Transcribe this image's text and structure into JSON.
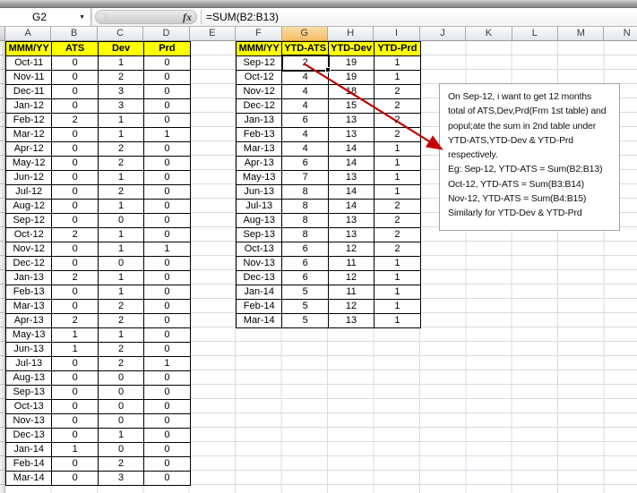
{
  "chrome": {
    "name_box": "G2",
    "fx_label": "fx",
    "formula": "=SUM(B2:B13)"
  },
  "column_headers": {
    "letters": [
      "A",
      "B",
      "C",
      "D",
      "E",
      "F",
      "G",
      "H",
      "I",
      "J",
      "K",
      "L",
      "M",
      "N"
    ],
    "selected": "G"
  },
  "sheet": {
    "table1": {
      "headers": [
        "MMM/YY",
        "ATS",
        "Dev",
        "Prd"
      ],
      "rows": [
        [
          "Oct-11",
          "0",
          "1",
          "0"
        ],
        [
          "Nov-11",
          "0",
          "2",
          "0"
        ],
        [
          "Dec-11",
          "0",
          "3",
          "0"
        ],
        [
          "Jan-12",
          "0",
          "3",
          "0"
        ],
        [
          "Feb-12",
          "2",
          "1",
          "0"
        ],
        [
          "Mar-12",
          "0",
          "1",
          "1"
        ],
        [
          "Apr-12",
          "0",
          "2",
          "0"
        ],
        [
          "May-12",
          "0",
          "2",
          "0"
        ],
        [
          "Jun-12",
          "0",
          "1",
          "0"
        ],
        [
          "Jul-12",
          "0",
          "2",
          "0"
        ],
        [
          "Aug-12",
          "0",
          "1",
          "0"
        ],
        [
          "Sep-12",
          "0",
          "0",
          "0"
        ],
        [
          "Oct-12",
          "2",
          "1",
          "0"
        ],
        [
          "Nov-12",
          "0",
          "1",
          "1"
        ],
        [
          "Dec-12",
          "0",
          "0",
          "0"
        ],
        [
          "Jan-13",
          "2",
          "1",
          "0"
        ],
        [
          "Feb-13",
          "0",
          "1",
          "0"
        ],
        [
          "Mar-13",
          "0",
          "2",
          "0"
        ],
        [
          "Apr-13",
          "2",
          "2",
          "0"
        ],
        [
          "May-13",
          "1",
          "1",
          "0"
        ],
        [
          "Jun-13",
          "1",
          "2",
          "0"
        ],
        [
          "Jul-13",
          "0",
          "2",
          "1"
        ],
        [
          "Aug-13",
          "0",
          "0",
          "0"
        ],
        [
          "Sep-13",
          "0",
          "0",
          "0"
        ],
        [
          "Oct-13",
          "0",
          "0",
          "0"
        ],
        [
          "Nov-13",
          "0",
          "0",
          "0"
        ],
        [
          "Dec-13",
          "0",
          "1",
          "0"
        ],
        [
          "Jan-14",
          "1",
          "0",
          "0"
        ],
        [
          "Feb-14",
          "0",
          "2",
          "0"
        ],
        [
          "Mar-14",
          "0",
          "3",
          "0"
        ]
      ]
    },
    "table2": {
      "headers": [
        "MMM/YY",
        "YTD-ATS",
        "YTD-Dev",
        "YTD-Prd"
      ],
      "rows": [
        [
          "Sep-12",
          "2",
          "19",
          "1"
        ],
        [
          "Oct-12",
          "4",
          "19",
          "1"
        ],
        [
          "Nov-12",
          "4",
          "18",
          "2"
        ],
        [
          "Dec-12",
          "4",
          "15",
          "2"
        ],
        [
          "Jan-13",
          "6",
          "13",
          "2"
        ],
        [
          "Feb-13",
          "4",
          "13",
          "2"
        ],
        [
          "Mar-13",
          "4",
          "14",
          "1"
        ],
        [
          "Apr-13",
          "6",
          "14",
          "1"
        ],
        [
          "May-13",
          "7",
          "13",
          "1"
        ],
        [
          "Jun-13",
          "8",
          "14",
          "1"
        ],
        [
          "Jul-13",
          "8",
          "14",
          "2"
        ],
        [
          "Aug-13",
          "8",
          "13",
          "2"
        ],
        [
          "Sep-13",
          "8",
          "13",
          "2"
        ],
        [
          "Oct-13",
          "6",
          "12",
          "2"
        ],
        [
          "Nov-13",
          "6",
          "11",
          "1"
        ],
        [
          "Dec-13",
          "6",
          "12",
          "1"
        ],
        [
          "Jan-14",
          "5",
          "11",
          "1"
        ],
        [
          "Feb-14",
          "5",
          "12",
          "1"
        ],
        [
          "Mar-14",
          "5",
          "13",
          "1"
        ]
      ]
    },
    "selection": {
      "cell_ref": "G2",
      "value": "2"
    },
    "annotation": {
      "lines": [
        "On Sep-12, i want to get 12 months",
        "total of ATS,Dev,Prd(Frm 1st table) and",
        "popul;ate the sum in 2nd table under",
        "YTD-ATS,YTD-Dev & YTD-Prd",
        "respectively.",
        "Eg: Sep-12, YTD-ATS = Sum(B2:B13)",
        "Oct-12, YTD-ATS = Sum(B3:B14)",
        "Nov-12, YTD-ATS = Sum(B4:B15)",
        "Similarly for YTD-Dev & YTD-Prd"
      ]
    }
  },
  "colors": {
    "header_yellow": "#FFFF00",
    "selected_header_orange": "#F5BE68",
    "arrow_red": "#C00000",
    "grid_line": "#D6DCE4"
  }
}
